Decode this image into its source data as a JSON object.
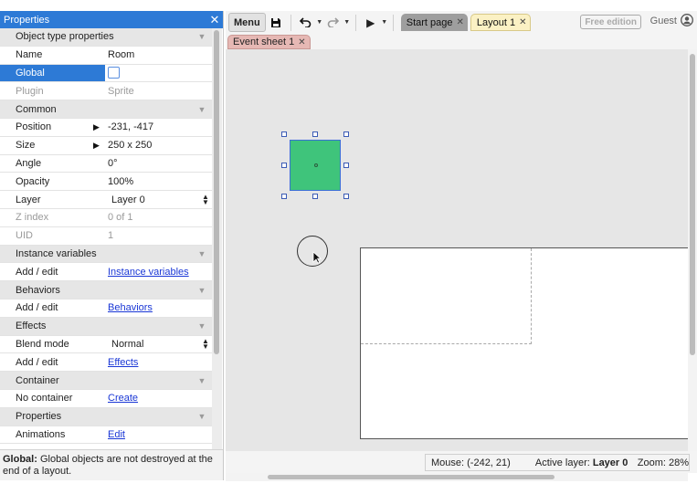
{
  "properties_panel": {
    "title": "Properties",
    "rows": [
      {
        "type": "section",
        "label": "Object type properties"
      },
      {
        "type": "prop",
        "key": "Name",
        "value": "Room"
      },
      {
        "type": "prop",
        "key": "Global",
        "value": "",
        "control": "checkbox",
        "selected": true
      },
      {
        "type": "prop",
        "key": "Plugin",
        "value": "Sprite",
        "dim": true
      },
      {
        "type": "section",
        "label": "Common"
      },
      {
        "type": "prop",
        "key": "Position",
        "value": "-231, -417",
        "expandable": true
      },
      {
        "type": "prop",
        "key": "Size",
        "value": "250 x 250",
        "expandable": true
      },
      {
        "type": "prop",
        "key": "Angle",
        "value": "0°"
      },
      {
        "type": "prop",
        "key": "Opacity",
        "value": "100%"
      },
      {
        "type": "prop",
        "key": "Layer",
        "value": "Layer 0",
        "control": "dropdown"
      },
      {
        "type": "prop",
        "key": "Z index",
        "value": "0 of 1",
        "dim": true
      },
      {
        "type": "prop",
        "key": "UID",
        "value": "1",
        "dim": true
      },
      {
        "type": "section",
        "label": "Instance variables"
      },
      {
        "type": "prop",
        "key": "Add / edit",
        "value": "Instance variables",
        "link": true
      },
      {
        "type": "section",
        "label": "Behaviors"
      },
      {
        "type": "prop",
        "key": "Add / edit",
        "value": "Behaviors",
        "link": true
      },
      {
        "type": "section",
        "label": "Effects"
      },
      {
        "type": "prop",
        "key": "Blend mode",
        "value": "Normal",
        "control": "dropdown"
      },
      {
        "type": "prop",
        "key": "Add / edit",
        "value": "Effects",
        "link": true
      },
      {
        "type": "section",
        "label": "Container"
      },
      {
        "type": "prop",
        "key": "No container",
        "value": "Create",
        "link": true
      },
      {
        "type": "section",
        "label": "Properties"
      },
      {
        "type": "prop",
        "key": "Animations",
        "value": "Edit",
        "link": true
      }
    ],
    "help": {
      "bold": "Global:",
      "text": " Global objects are not destroyed at the end of a layout."
    }
  },
  "toolbar": {
    "menu_label": "Menu",
    "tabs": [
      {
        "label": "Start page",
        "active": false
      },
      {
        "label": "Layout 1",
        "active": true
      }
    ],
    "edition_badge": "Free edition",
    "user_label": "Guest"
  },
  "subtabs": [
    {
      "label": "Event sheet 1"
    }
  ],
  "statusbar": {
    "mouse_label": "Mouse: (-242, 21)",
    "layer_label": "Active layer: ",
    "layer_value": "Layer 0",
    "zoom_label": "Zoom: 28%"
  },
  "colors": {
    "accent": "#2d7ad6",
    "sprite_fill": "#3fc47b",
    "layout_tab": "#fbf1c4",
    "event_tab": "#e6b8b4"
  }
}
